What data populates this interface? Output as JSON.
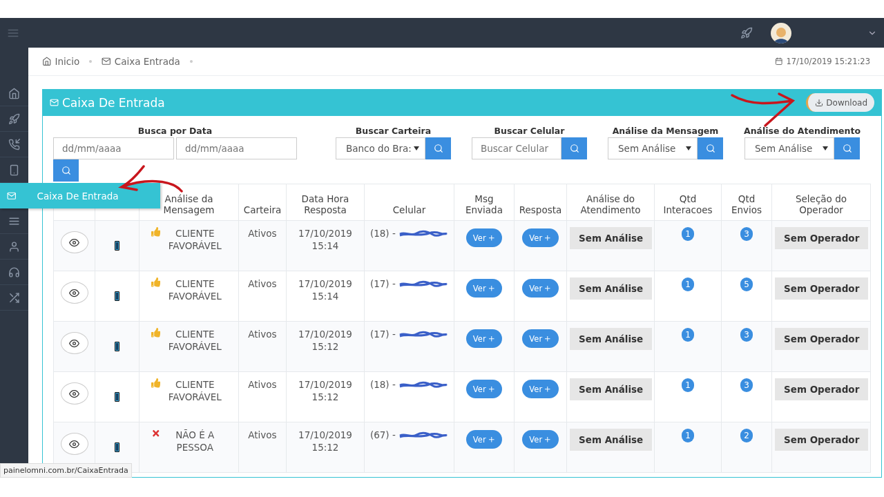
{
  "breadcrumb": [
    {
      "label": "Inicio",
      "kind": "home"
    },
    {
      "label": "Caixa Entrada",
      "kind": "mail"
    }
  ],
  "clock": "17/10/2019  15:21:23",
  "sidebar": {
    "items": [
      {
        "kind": "home"
      },
      {
        "kind": "rocket"
      },
      {
        "kind": "phone"
      },
      {
        "kind": "mobile"
      },
      {
        "kind": "mail",
        "label": "Caixa De Entrada",
        "selected": true
      },
      {
        "kind": "list"
      },
      {
        "kind": "user"
      },
      {
        "kind": "headset"
      },
      {
        "kind": "shuffle"
      }
    ]
  },
  "panel": {
    "title": "Caixa De Entrada",
    "download": "Download"
  },
  "filters": {
    "date": {
      "label": "Busca por Data",
      "from_placeholder": "dd/mm/aaaa",
      "to_placeholder": "dd/mm/aaaa"
    },
    "others": [
      {
        "label": "Buscar Carteira",
        "kind": "select",
        "value": "Banco do Bra:"
      },
      {
        "label": "Buscar Celular",
        "kind": "input",
        "placeholder": "Buscar Celular"
      },
      {
        "label": "Análise da Mensagem",
        "kind": "select",
        "value": "Sem Análise"
      },
      {
        "label": "Análise do Atendimento",
        "kind": "select",
        "value": "Sem Análise"
      }
    ]
  },
  "table": {
    "columns": [
      "Análise da Mensagem",
      "Carteira",
      "Data Hora Resposta",
      "Celular",
      "Msg Enviada",
      "Resposta",
      "Análise do Atendimento",
      "Qtd Interacoes",
      "Qtd Envios",
      "Seleção do Operador"
    ],
    "rows": [
      {
        "analysis": "CLIENTE FAVORÁVEL",
        "kind": "positive",
        "carteira": "Ativos",
        "date": "17/10/2019",
        "time": "15:14",
        "ddd": "(18) -",
        "sent": "Ver",
        "reply": "Ver",
        "service": "Sem Análise",
        "interactions": "1",
        "sends": "3",
        "operator": "Sem Operador"
      },
      {
        "analysis": "CLIENTE FAVORÁVEL",
        "kind": "positive",
        "carteira": "Ativos",
        "date": "17/10/2019",
        "time": "15:14",
        "ddd": "(17) -",
        "sent": "Ver",
        "reply": "Ver",
        "service": "Sem Análise",
        "interactions": "1",
        "sends": "5",
        "operator": "Sem Operador"
      },
      {
        "analysis": "CLIENTE FAVORÁVEL",
        "kind": "positive",
        "carteira": "Ativos",
        "date": "17/10/2019",
        "time": "15:12",
        "ddd": "(17) -",
        "sent": "Ver",
        "reply": "Ver",
        "service": "Sem Análise",
        "interactions": "1",
        "sends": "3",
        "operator": "Sem Operador"
      },
      {
        "analysis": "CLIENTE FAVORÁVEL",
        "kind": "positive",
        "carteira": "Ativos",
        "date": "17/10/2019",
        "time": "15:12",
        "ddd": "(18) -",
        "sent": "Ver",
        "reply": "Ver",
        "service": "Sem Análise",
        "interactions": "1",
        "sends": "3",
        "operator": "Sem Operador"
      },
      {
        "analysis": "NÃO É A PESSOA",
        "kind": "negative",
        "carteira": "Ativos",
        "date": "17/10/2019",
        "time": "15:12",
        "ddd": "(67) -",
        "sent": "Ver",
        "reply": "Ver",
        "service": "Sem Análise",
        "interactions": "1",
        "sends": "2",
        "operator": "Sem Operador"
      }
    ]
  },
  "status_url": "painelomni.com.br/CaixaEntrada"
}
